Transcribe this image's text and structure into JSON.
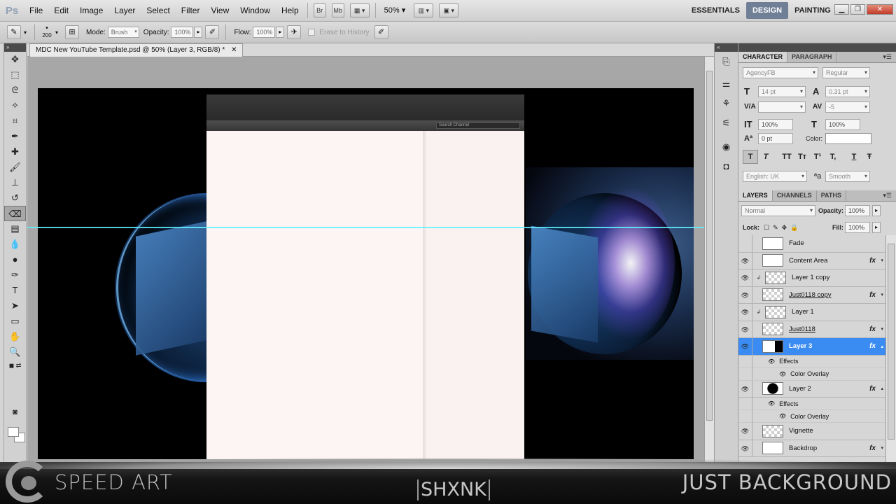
{
  "app": {
    "logo": "Ps"
  },
  "menu": [
    "File",
    "Edit",
    "Image",
    "Layer",
    "Select",
    "Filter",
    "View",
    "Window",
    "Help"
  ],
  "menubar_tools": {
    "bridge": "Br",
    "minibridge": "Mb",
    "zoom": "50%"
  },
  "workspaces": [
    "ESSENTIALS",
    "DESIGN",
    "PAINTING"
  ],
  "workspace_more": "»",
  "options": {
    "brush_size": "200",
    "mode_label": "Mode:",
    "mode_value": "Brush",
    "opacity_label": "Opacity:",
    "opacity_value": "100%",
    "flow_label": "Flow:",
    "flow_value": "100%",
    "erase_history": "Erase to History"
  },
  "document": {
    "tab_title": "MDC New YouTube Template.psd @ 50% (Layer 3, RGB/8) *",
    "search_placeholder": "Search Channel"
  },
  "character_panel": {
    "tabs": [
      "CHARACTER",
      "PARAGRAPH"
    ],
    "font_family": "AgencyFB",
    "font_style": "Regular",
    "font_size": "14 pt",
    "leading": "0.31 pt",
    "kerning": "",
    "tracking": "-5",
    "vscale": "100%",
    "hscale": "100%",
    "baseline": "0 pt",
    "color_label": "Color:",
    "language": "English: UK",
    "aa_label": "ªa",
    "antialias": "Smooth",
    "styles": [
      "T",
      "T",
      "TT",
      "Tт",
      "T¹",
      "T,",
      "T",
      "Ŧ"
    ]
  },
  "layers_panel": {
    "tabs": [
      "LAYERS",
      "CHANNELS",
      "PATHS"
    ],
    "blend_mode": "Normal",
    "opacity_label": "Opacity:",
    "opacity_value": "100%",
    "lock_label": "Lock:",
    "fill_label": "Fill:",
    "fill_value": "100%",
    "layers": [
      {
        "name": "Fade",
        "visible": false,
        "fx": false,
        "selected": false,
        "thumb": "plain"
      },
      {
        "name": "Content Area",
        "visible": true,
        "fx": true,
        "selected": false,
        "thumb": "plain"
      },
      {
        "name": "Layer 1 copy",
        "visible": true,
        "fx": false,
        "selected": false,
        "thumb": "checker",
        "clipped": true
      },
      {
        "name": "Just0118 copy",
        "visible": true,
        "fx": true,
        "selected": false,
        "thumb": "checker",
        "underline": true
      },
      {
        "name": "Layer 1",
        "visible": true,
        "fx": false,
        "selected": false,
        "thumb": "checker",
        "clipped": true
      },
      {
        "name": "Just0118",
        "visible": true,
        "fx": true,
        "selected": false,
        "thumb": "checker",
        "underline": true
      },
      {
        "name": "Layer 3",
        "visible": true,
        "fx": true,
        "selected": true,
        "thumb": "mask"
      },
      {
        "name": "Layer 2",
        "visible": true,
        "fx": true,
        "selected": false,
        "thumb": "dark"
      },
      {
        "name": "Vignette",
        "visible": true,
        "fx": false,
        "selected": false,
        "thumb": "checker"
      },
      {
        "name": "Backdrop",
        "visible": true,
        "fx": true,
        "selected": false,
        "thumb": "plain"
      }
    ],
    "effects_label": "Effects",
    "color_overlay_label": "Color Overlay"
  },
  "overlay": {
    "left": "SPEED ART",
    "center": "SHXNK",
    "right": "JUST BACKGROUND"
  },
  "colors": {
    "accent": "#3b8cf2",
    "guide": "#5ff2ff",
    "workspace_active": "#6f7f96"
  }
}
